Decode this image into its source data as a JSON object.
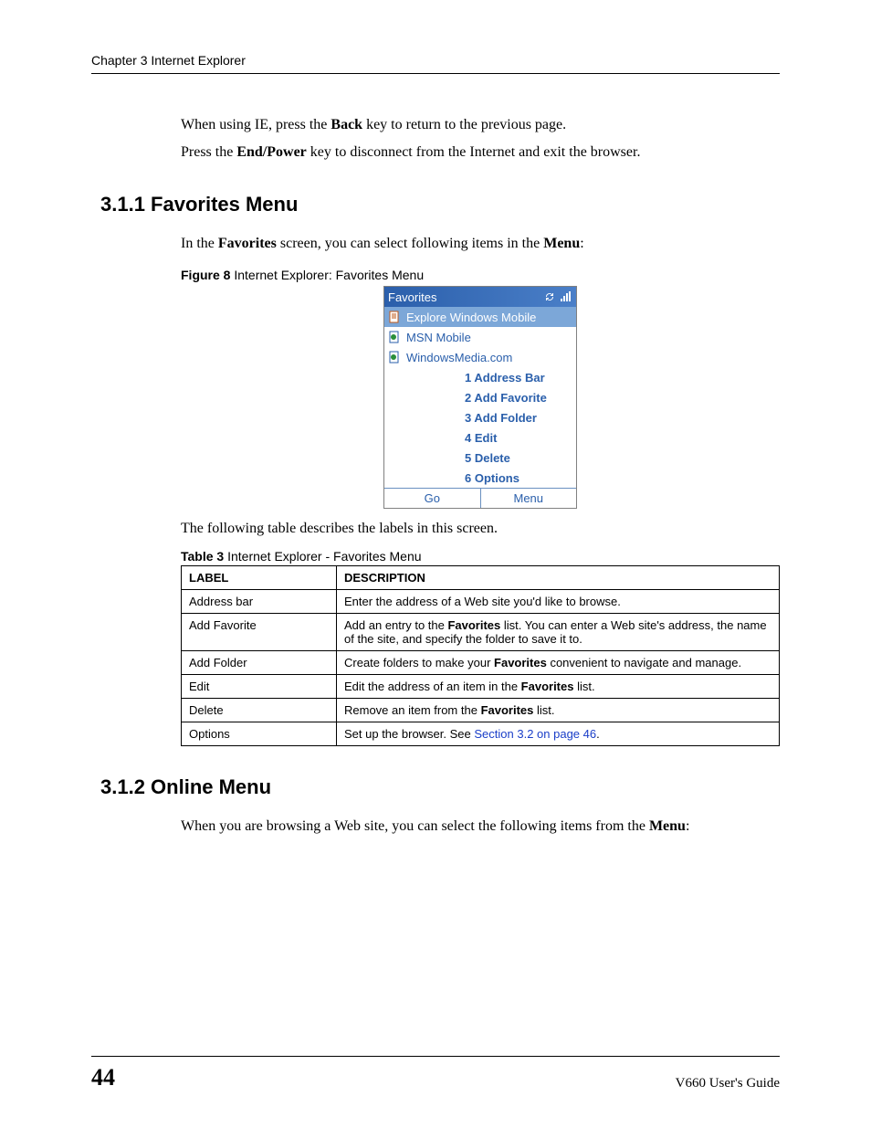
{
  "header": {
    "chapter": "Chapter 3 Internet Explorer"
  },
  "intro": {
    "p1_a": "When using IE, press the ",
    "p1_b": "Back",
    "p1_c": " key to return to the previous page.",
    "p2_a": "Press the ",
    "p2_b": "End/Power",
    "p2_c": " key to disconnect from the Internet and exit the browser."
  },
  "sec311": {
    "heading": "3.1.1  Favorites Menu",
    "para_a": "In the ",
    "para_b": "Favorites",
    "para_c": " screen, you can select following items in the ",
    "para_d": "Menu",
    "para_e": ":",
    "fig_label_bold": "Figure 8",
    "fig_label_rest": "   Internet Explorer: Favorites Menu",
    "phone": {
      "title": "Favorites",
      "items": [
        "Explore Windows Mobile",
        "MSN Mobile",
        "WindowsMedia.com"
      ],
      "menu": [
        "1 Address Bar",
        "2 Add Favorite",
        "3 Add Folder",
        "4 Edit",
        "5 Delete",
        "6 Options"
      ],
      "soft_left": "Go",
      "soft_right": "Menu"
    },
    "after_fig": "The following table describes the labels in this screen.",
    "tbl_label_bold": "Table 3",
    "tbl_label_rest": "   Internet Explorer - Favorites Menu",
    "table": {
      "head_label": "LABEL",
      "head_desc": "DESCRIPTION",
      "rows": [
        {
          "label": "Address bar",
          "desc_pre": "Enter the address of a Web site you'd like to browse.",
          "desc_bold": "",
          "desc_post": ""
        },
        {
          "label": "Add Favorite",
          "desc_pre": "Add an entry to the ",
          "desc_bold": "Favorites",
          "desc_post": " list. You can enter a Web site's address, the name of the site, and specify the folder to save it to."
        },
        {
          "label": "Add Folder",
          "desc_pre": "Create folders to make your ",
          "desc_bold": "Favorites",
          "desc_post": " convenient to navigate and manage."
        },
        {
          "label": "Edit",
          "desc_pre": "Edit the address of an item in the ",
          "desc_bold": "Favorites",
          "desc_post": " list."
        },
        {
          "label": "Delete",
          "desc_pre": "Remove an item from the ",
          "desc_bold": "Favorites",
          "desc_post": " list."
        },
        {
          "label": "Options",
          "desc_pre": "Set up the browser. See ",
          "desc_link": "Section 3.2 on page 46",
          "desc_post2": "."
        }
      ]
    }
  },
  "sec312": {
    "heading": "3.1.2  Online Menu",
    "para_a": "When you are browsing a Web site, you can select the following items from the ",
    "para_b": "Menu",
    "para_c": ":"
  },
  "footer": {
    "page": "44",
    "guide": "V660 User's Guide"
  }
}
